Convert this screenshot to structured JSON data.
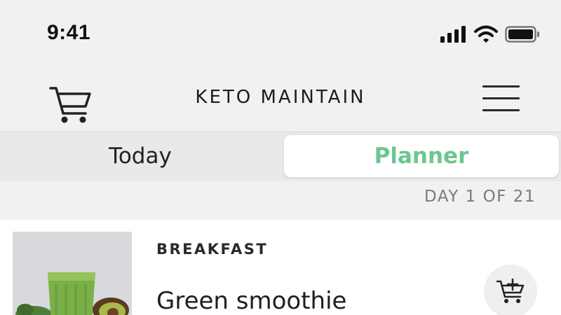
{
  "status_bar": {
    "time": "9:41"
  },
  "header": {
    "title": "KETO MAINTAIN",
    "cart_icon": "shopping-cart-icon",
    "menu_icon": "hamburger-menu-icon"
  },
  "tabs": [
    {
      "label": "Today",
      "active": false
    },
    {
      "label": "Planner",
      "active": true
    }
  ],
  "day_counter": "DAY 1 OF 21",
  "meal": {
    "category": "BREAKFAST",
    "name": "Green smoothie",
    "image": "green-smoothie-photo",
    "add_icon": "add-to-cart-icon"
  },
  "colors": {
    "accent": "#6cc78e",
    "background": "#f1f1f1",
    "segment_bg": "#e9e9e9",
    "card_bg": "#ffffff"
  }
}
